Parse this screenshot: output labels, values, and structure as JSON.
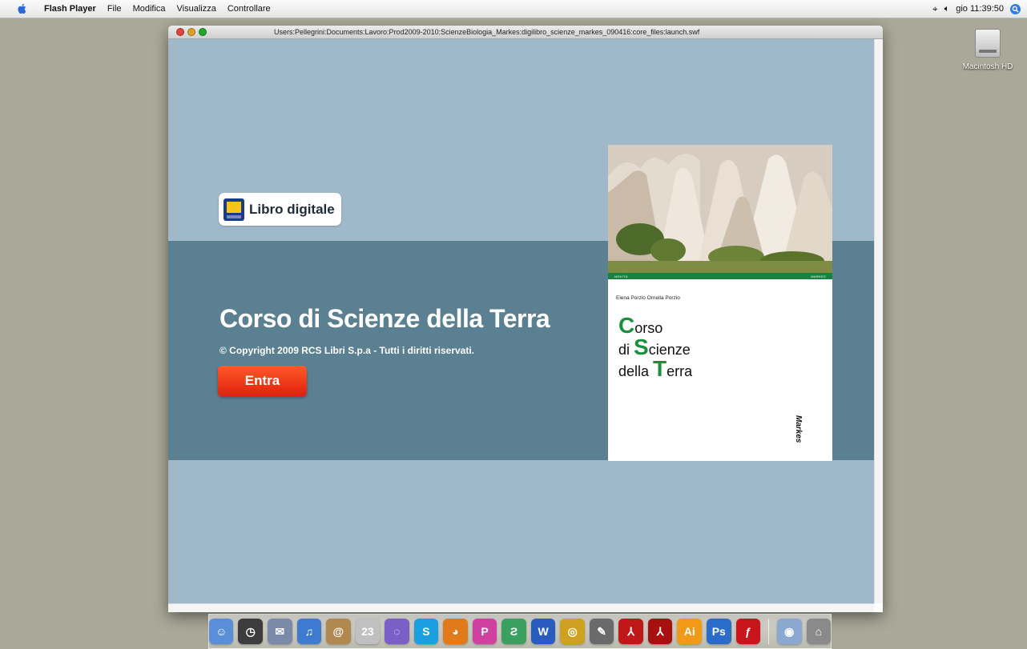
{
  "menubar": {
    "app_name": "Flash Player",
    "items": [
      "File",
      "Modifica",
      "Visualizza",
      "Controllare"
    ],
    "clock": "gio 11:39:50"
  },
  "desktop": {
    "hd_label": "Macintosh HD"
  },
  "window": {
    "title": "Users:Pellegrini:Documents:Lavoro:Prod2009-2010:ScienzeBiologia_Markes:digilibro_scienze_markes_090416:core_files:launch.swf"
  },
  "launch": {
    "badge_label": "Libro digitale",
    "course_title": "Corso di Scienze della Terra",
    "copyright": "© Copyright 2009 RCS Libri S.p.a - Tutti i diritti riservati.",
    "enter_label": "Entra"
  },
  "cover": {
    "strip_left": "NOVITÀ",
    "strip_right": "MARKES",
    "authors": "Elena Porzio   Ornella Porzio",
    "title_lines": [
      {
        "cap": "C",
        "rest": "orso",
        "prefix": ""
      },
      {
        "cap": "S",
        "rest": "cienze",
        "prefix": "di "
      },
      {
        "cap": "T",
        "rest": "erra",
        "prefix": "della "
      }
    ],
    "publisher": "Markes"
  },
  "dock": {
    "apps": [
      {
        "name": "finder",
        "glyph": "☺",
        "color": "#5a8fd8"
      },
      {
        "name": "dashboard",
        "glyph": "◷",
        "color": "#3d3d3d"
      },
      {
        "name": "mail",
        "glyph": "✉",
        "color": "#7a8aa8"
      },
      {
        "name": "itunes",
        "glyph": "♫",
        "color": "#3c7bd0"
      },
      {
        "name": "address-book",
        "glyph": "@",
        "color": "#b08850"
      },
      {
        "name": "ical",
        "glyph": "23",
        "color": "#c0c0c0"
      },
      {
        "name": "ichat",
        "glyph": "◌",
        "color": "#7b5fc8"
      },
      {
        "name": "skype",
        "glyph": "S",
        "color": "#1aa0e0"
      },
      {
        "name": "firefox",
        "glyph": "◕",
        "color": "#e07a1a"
      },
      {
        "name": "pages",
        "glyph": "P",
        "color": "#d040a0"
      },
      {
        "name": "dreamweaver",
        "glyph": "Ƨ",
        "color": "#3aa060"
      },
      {
        "name": "app-blue",
        "glyph": "W",
        "color": "#2a5cc0"
      },
      {
        "name": "app-network",
        "glyph": "◎",
        "color": "#d0a020"
      },
      {
        "name": "app-tools",
        "glyph": "✎",
        "color": "#6a6a6a"
      },
      {
        "name": "acrobat-reader",
        "glyph": "⅄",
        "color": "#c01818"
      },
      {
        "name": "acrobat-pro",
        "glyph": "⅄",
        "color": "#a81010"
      },
      {
        "name": "illustrator",
        "glyph": "Ai",
        "color": "#f19a1a"
      },
      {
        "name": "photoshop",
        "glyph": "Ps",
        "color": "#2a6cc8"
      },
      {
        "name": "flash",
        "glyph": "ƒ",
        "color": "#c8141a"
      }
    ],
    "extras": [
      {
        "name": "downloads-stack",
        "glyph": "◉",
        "color": "#8aa8d0"
      },
      {
        "name": "trash",
        "glyph": "⌂",
        "color": "#8a8a8a"
      }
    ]
  }
}
